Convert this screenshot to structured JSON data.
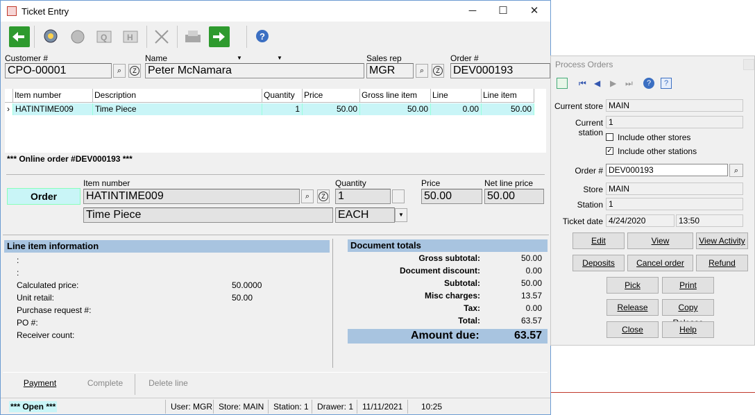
{
  "window": {
    "title": "Ticket Entry",
    "minimize": "─",
    "maximize": "☐",
    "close": "✕"
  },
  "header": {
    "customer_label": "Customer #",
    "customer": "CPO-00001",
    "name_label": "Name",
    "name": "Peter McNamara",
    "salesrep_label": "Sales rep",
    "salesrep": "MGR",
    "order_label": "Order #",
    "order": "DEV000193",
    "z": "Z"
  },
  "grid": {
    "columns": [
      "Item number",
      "Description",
      "Quantity",
      "Price",
      "Gross line item price",
      "Line discount",
      "Line item price"
    ],
    "row": [
      "HATINTIME009",
      "Time Piece",
      "1",
      "50.00",
      "50.00",
      "0.00",
      "50.00"
    ]
  },
  "online_order": "*** Online order #DEV000193 ***",
  "entry": {
    "mode": "Order",
    "item_label": "Item number",
    "item": "HATINTIME009",
    "desc": "Time Piece",
    "qty_label": "Quantity",
    "qty": "1",
    "unit": "EACH",
    "price_label": "Price",
    "price": "50.00",
    "net_label": "Net line price",
    "net": "50.00"
  },
  "line_info": {
    "title": "Line item information",
    "rows": [
      {
        "k": ":",
        "v": ""
      },
      {
        "k": ":",
        "v": ""
      },
      {
        "k": "Calculated price:",
        "v": "50.0000"
      },
      {
        "k": "Unit retail:",
        "v": "50.00"
      },
      {
        "k": "Purchase request #:",
        "v": ""
      },
      {
        "k": "PO #:",
        "v": ""
      },
      {
        "k": "Receiver count:",
        "v": ""
      }
    ]
  },
  "totals": {
    "title": "Document totals",
    "rows": [
      {
        "k": "Gross subtotal:",
        "v": "50.00"
      },
      {
        "k": "Document discount:",
        "v": "0.00"
      },
      {
        "k": "Subtotal:",
        "v": "50.00"
      },
      {
        "k": "Misc charges:",
        "v": "13.57"
      },
      {
        "k": "Tax:",
        "v": "0.00"
      },
      {
        "k": "Total:",
        "v": "63.57"
      }
    ],
    "amount_label": "Amount due:",
    "amount": "63.57"
  },
  "actions": {
    "payment": "Payment",
    "complete": "Complete",
    "delete": "Delete line"
  },
  "status": {
    "state": "*** Open ***",
    "user": "User: MGR",
    "store": "Store: MAIN",
    "station": "Station: 1",
    "drawer": "Drawer: 1",
    "date": "11/11/2021",
    "time": "10:25"
  },
  "process": {
    "title": "Process Orders",
    "current_store_label": "Current store",
    "current_store": "MAIN",
    "current_station_label": "Current station",
    "current_station": "1",
    "include_stores": "Include other stores",
    "include_stations": "Include other stations",
    "order_label": "Order #",
    "order": "DEV000193",
    "store_label": "Store",
    "store": "MAIN",
    "station_label": "Station",
    "station": "1",
    "ticket_date_label": "Ticket date",
    "ticket_date": "4/24/2020",
    "ticket_time": "13:50",
    "buttons": {
      "edit": "Edit",
      "view": "View",
      "activity": "View Activity",
      "deposits": "Deposits",
      "cancel": "Cancel order",
      "refund": "Refund",
      "pick": "Pick",
      "print": "Print",
      "release": "Release",
      "copy_release": "Copy Release",
      "close": "Close",
      "help": "Help"
    }
  },
  "colors": {
    "accent": "#a8c4e0",
    "row_highlight": "#c9f5f7",
    "order_mode": "#c9f5f7"
  }
}
